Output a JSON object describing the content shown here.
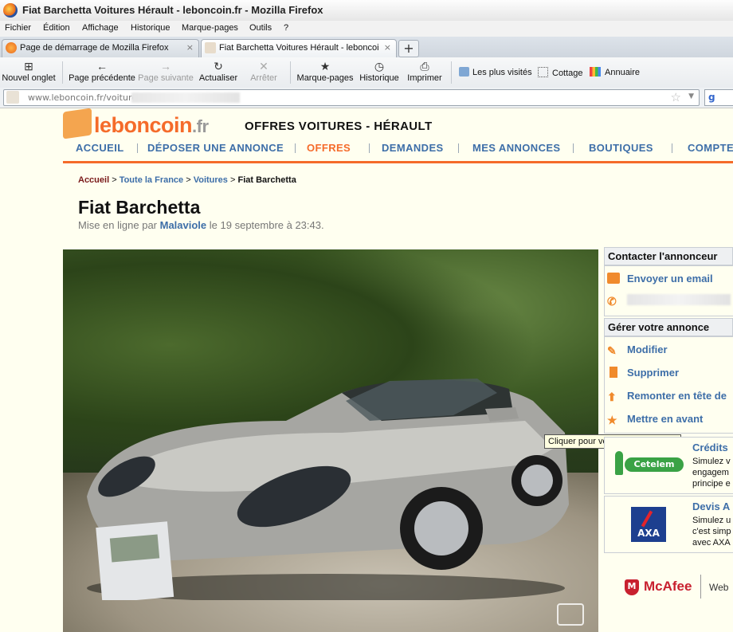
{
  "window": {
    "title": "Fiat Barchetta Voitures Hérault - leboncoin.fr - Mozilla Firefox"
  },
  "menu": [
    "Fichier",
    "Édition",
    "Affichage",
    "Historique",
    "Marque-pages",
    "Outils",
    "?"
  ],
  "tabs": [
    {
      "label": "Page de démarrage de Mozilla Firefox",
      "close": "×"
    },
    {
      "label": "Fiat Barchetta Voitures Hérault - leboncoi...",
      "close": "×"
    }
  ],
  "toolbar": {
    "new_tab": "Nouvel onglet",
    "back": "Page précédente",
    "forward": "Page suivante",
    "reload": "Actualiser",
    "stop": "Arrêter",
    "bookmarks": "Marque-pages",
    "history": "Historique",
    "print": "Imprimer"
  },
  "bookmarks_bar": [
    "Les plus visités",
    "Cottage",
    "Annuaire"
  ],
  "urlbar": {
    "url": "www.leboncoin.fr/voiture"
  },
  "site": {
    "logo_main": "leboncoin",
    "logo_tld": ".fr",
    "header_title": "OFFRES VOITURES - HÉRAULT",
    "nav": [
      "ACCUEIL",
      "DÉPOSER UNE ANNONCE",
      "OFFRES",
      "DEMANDES",
      "MES ANNONCES",
      "BOUTIQUES",
      "COMPTE"
    ],
    "nav_active": "OFFRES",
    "accent_color": "#f56b2a",
    "link_color": "#3d6ea8"
  },
  "breadcrumb": [
    "Accueil",
    "Toute la France",
    "Voitures",
    "Fiat Barchetta"
  ],
  "ad": {
    "title": "Fiat Barchetta",
    "posted_prefix": "Mise en ligne par",
    "author": "Malaviole",
    "posted_suffix": "le 19 septembre à 23:43."
  },
  "photo": {
    "tooltip": "Cliquer pour voir l'image suivante"
  },
  "sidebar": {
    "contact_title": "Contacter l'annonceur",
    "send_email": "Envoyer un email",
    "manage_title": "Gérer votre annonce",
    "actions": [
      "Modifier",
      "Supprimer",
      "Remonter en tête de",
      "Mettre en avant"
    ]
  },
  "promos": [
    {
      "title": "Crédits",
      "lines": [
        "Simulez v",
        "engagem",
        "principe e"
      ],
      "brand": "Cetelem"
    },
    {
      "title": "Devis A",
      "lines": [
        "Simulez u",
        "c'est simp",
        "avec AXA"
      ],
      "brand": "AXA"
    }
  ],
  "mcafee": {
    "brand": "McAfee",
    "suffix": "Web"
  }
}
